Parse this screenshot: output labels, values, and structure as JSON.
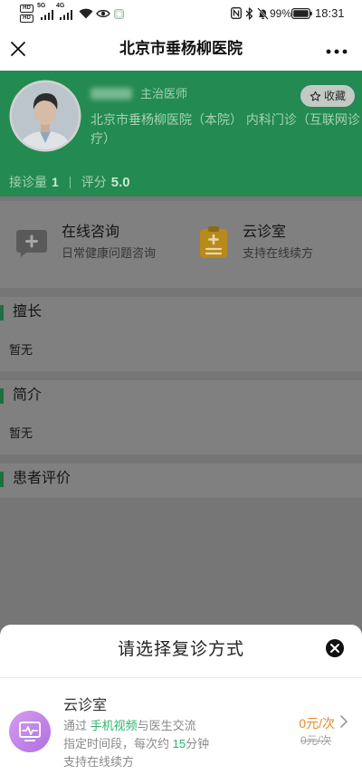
{
  "status_bar": {
    "hd_badges": [
      "HD",
      "HD"
    ],
    "sim1_network": "5G",
    "sim2_network": "4G",
    "battery_text": "99%",
    "battery_level": 0.99,
    "time": "18:31",
    "left_icons": [
      "signal-icon",
      "signal-icon",
      "wifi-icon",
      "eye-icon",
      "notification-icon"
    ],
    "right_icons": [
      "nfc-icon",
      "bluetooth-icon",
      "mute-icon",
      "battery-icon"
    ]
  },
  "header": {
    "title": "北京市垂杨柳医院",
    "close_icon": "close-icon",
    "more_icon": "more-icon"
  },
  "doctor": {
    "avatar_icon": "doctor-avatar",
    "title": "主治医师",
    "favorite_label": "收藏",
    "favorite_icon": "star-icon",
    "department": "北京市垂杨柳医院（本院） 内科门诊（互联网诊疗）",
    "stats": {
      "consults_label": "接诊量",
      "consults_value": "1",
      "rating_label": "评分",
      "rating_value": "5.0"
    }
  },
  "services": [
    {
      "name": "在线咨询",
      "desc": "日常健康问题咨询",
      "icon": "chat-plus-icon"
    },
    {
      "name": "云诊室",
      "desc": "支持在线续方",
      "icon": "medical-record-icon"
    }
  ],
  "sections": [
    {
      "title": "擅长",
      "content": "暂无"
    },
    {
      "title": "简介",
      "content": "暂无"
    },
    {
      "title": "患者评价"
    }
  ],
  "sheet": {
    "title": "请选择复诊方式",
    "close_icon": "close-circle-icon",
    "option": {
      "icon": "video-consult-icon",
      "name": "云诊室",
      "line1": {
        "prefix": "通过 ",
        "highlight": "手机视频",
        "suffix": "与医生交流"
      },
      "line2": {
        "prefix": "指定时间段，每次约 ",
        "highlight": "15",
        "suffix": "分钟"
      },
      "line3": "支持在线续方",
      "price": "0元/次",
      "original_price": "0元/次",
      "arrow_icon": "chevron-right-icon"
    }
  },
  "colors": {
    "card_green": "#238a51",
    "highlight_green": "#2bb56a",
    "price_orange": "#e8892a",
    "option_icon_purple": "#c17fe0",
    "service_icon_yellow": "#b8891b"
  }
}
